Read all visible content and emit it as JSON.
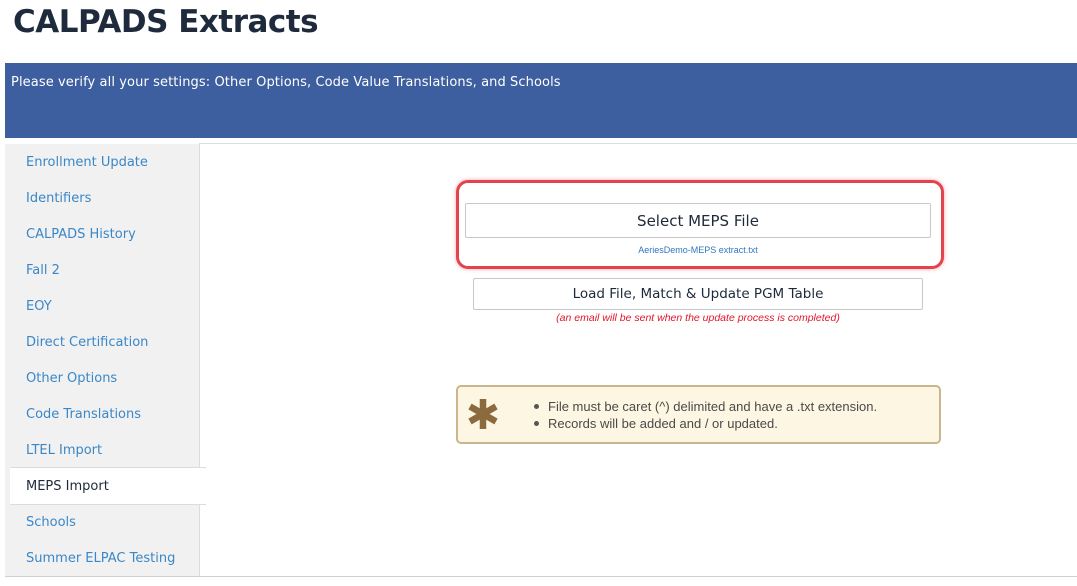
{
  "page": {
    "title": "CALPADS Extracts"
  },
  "banner": {
    "text": "Please verify all your settings: Other Options, Code Value Translations, and Schools"
  },
  "sidebar": {
    "items": [
      {
        "label": "Enrollment Update",
        "name": "sidebar-item-enrollment-update"
      },
      {
        "label": "Identifiers",
        "name": "sidebar-item-identifiers"
      },
      {
        "label": "CALPADS History",
        "name": "sidebar-item-calpads-history"
      },
      {
        "label": "Fall 2",
        "name": "sidebar-item-fall-2"
      },
      {
        "label": "EOY",
        "name": "sidebar-item-eoy"
      },
      {
        "label": "Direct Certification",
        "name": "sidebar-item-direct-certification"
      },
      {
        "label": "Other Options",
        "name": "sidebar-item-other-options"
      },
      {
        "label": "Code Translations",
        "name": "sidebar-item-code-translations"
      },
      {
        "label": "LTEL Import",
        "name": "sidebar-item-ltel-import"
      },
      {
        "label": "MEPS Import",
        "name": "sidebar-item-meps-import",
        "active": true
      },
      {
        "label": "Schools",
        "name": "sidebar-item-schools"
      },
      {
        "label": "Summer ELPAC Testing",
        "name": "sidebar-item-summer-elpac-testing"
      }
    ]
  },
  "main": {
    "select_button_label": "Select MEPS File",
    "selected_file": "AeriesDemo-MEPS extract.txt",
    "load_button_label": "Load File, Match & Update PGM Table",
    "email_note": "(an email will be sent when the update process is completed)",
    "notice": {
      "icon": "asterisk-icon",
      "items": [
        "File must be caret (^) delimited and have a .txt extension.",
        "Records will be added and / or updated."
      ]
    }
  },
  "colors": {
    "banner": "#3e5f9f",
    "link": "#3a87c7",
    "highlight": "#e2434d",
    "note_red": "#e0162b",
    "notice_bg": "#fdf6e3",
    "notice_icon": "#8b6a3e"
  }
}
